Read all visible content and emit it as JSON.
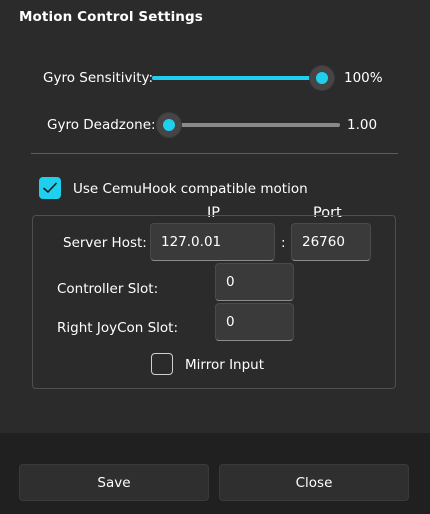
{
  "dialog": {
    "title": "Motion Control Settings"
  },
  "gyro_sensitivity": {
    "label": "Gyro Sensitivity:",
    "value_text": "100%",
    "fraction": 1.0
  },
  "gyro_deadzone": {
    "label": "Gyro Deadzone:",
    "value_text": "1.00",
    "fraction": 0.0
  },
  "cemuhook": {
    "checkbox_label": "Use CemuHook compatible motion",
    "checked": true,
    "ip_header": "IP",
    "port_header": "Port",
    "server_host_label": "Server Host:",
    "server_host_value": "127.0.01",
    "separator": ":",
    "port_value": "26760",
    "controller_slot_label": "Controller Slot:",
    "controller_slot_value": "0",
    "right_joycon_slot_label": "Right JoyCon Slot:",
    "right_joycon_slot_value": "0",
    "mirror_input_label": "Mirror Input",
    "mirror_input_checked": false
  },
  "footer": {
    "save_label": "Save",
    "close_label": "Close"
  },
  "colors": {
    "accent": "#1fd0ee",
    "background": "#2b2b2b",
    "footer": "#202020"
  }
}
